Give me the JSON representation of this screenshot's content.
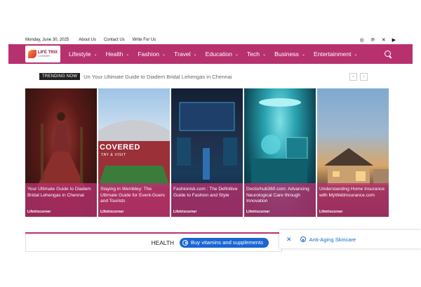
{
  "topbar": {
    "date": "Monday, June 30, 2025",
    "links": [
      "About Us",
      "Contact Us",
      "Write For Us"
    ],
    "social": [
      "instagram-icon",
      "pinterest-icon",
      "x-icon",
      "youtube-icon"
    ]
  },
  "nav": {
    "logo_text": "LIFE TRIX",
    "logo_sub": "CORNER",
    "items": [
      "Lifestyle",
      "Health",
      "Fashion",
      "Travel",
      "Education",
      "Tech",
      "Business",
      "Entertainment"
    ],
    "accent": "#b8316f"
  },
  "trending": {
    "label": "TRENDING NOW",
    "headline": "Un Your Ultimate Guide to Diadem Bridal Lehengas in Chennai",
    "prev": "‹",
    "next": "›"
  },
  "cards": [
    {
      "title": "Your Ultimate Guide to Diadem Bridal Lehengas in Chennai",
      "author": "Lifetrixcorner"
    },
    {
      "title": "Staying in Wembley: The Ultimate Guide for Event-Goers and Tourists",
      "author": "Lifetrixcorner",
      "overlay_text": "COVERED",
      "overlay_sub": "TAY & VISIT"
    },
    {
      "title": "Fashionisk.com : The Definitive Guide to Fashion and Style",
      "author": "Lifetrixcorner"
    },
    {
      "title": "Doctorhub360.com: Advancing Neurological Care through Innovation",
      "author": "Lifetrixcorner"
    },
    {
      "title": "Understanding Home Insurance with MyWebInsurance.com",
      "author": "Lifetrixcorner"
    }
  ],
  "bottom": {
    "section": "HEALTH",
    "pill": "Buy vitamins and supplements",
    "ad_close": "✕",
    "ad_text": "Anti-Aging Skincare"
  }
}
